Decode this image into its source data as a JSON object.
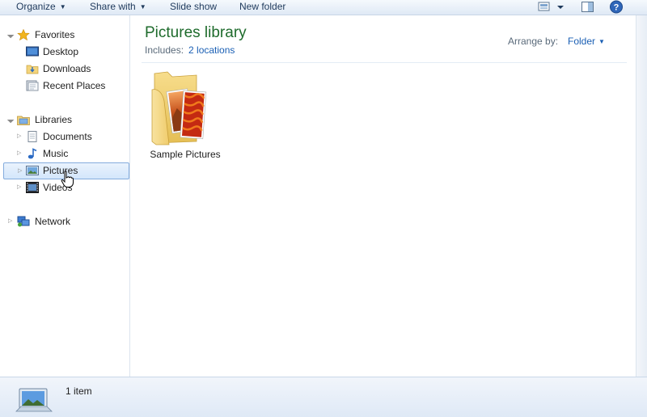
{
  "toolbar": {
    "organize": "Organize",
    "share_with": "Share with",
    "slide_show": "Slide show",
    "new_folder": "New folder"
  },
  "sidebar": {
    "favorites": "Favorites",
    "desktop": "Desktop",
    "downloads": "Downloads",
    "recent_places": "Recent Places",
    "libraries": "Libraries",
    "documents": "Documents",
    "music": "Music",
    "pictures": "Pictures",
    "videos": "Videos",
    "network": "Network"
  },
  "main": {
    "title": "Pictures library",
    "includes_label": "Includes:",
    "includes_link": "2 locations",
    "arrange_label": "Arrange by:",
    "arrange_value": "Folder",
    "items": [
      {
        "label": "Sample Pictures"
      }
    ]
  },
  "details": {
    "count": "1 item"
  }
}
